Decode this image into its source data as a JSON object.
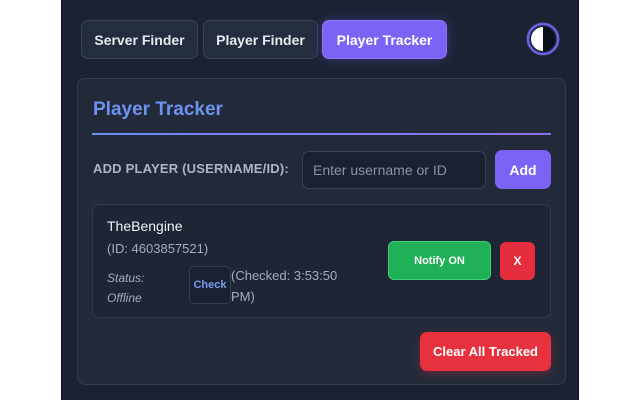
{
  "tabs": [
    {
      "label": "Server Finder",
      "active": false
    },
    {
      "label": "Player Finder",
      "active": false
    },
    {
      "label": "Player Tracker",
      "active": true
    }
  ],
  "theme_toggle": {
    "icon": "contrast-icon"
  },
  "panel": {
    "title": "Player Tracker",
    "add": {
      "label": "ADD PLAYER (USERNAME/ID):",
      "placeholder": "Enter username or ID",
      "value": "",
      "button_label": "Add"
    },
    "players": [
      {
        "name": "TheBengine",
        "id_text": "(ID: 4603857521)",
        "status_label": "Status:",
        "status_value": "Offline",
        "check_label": "Check",
        "checked_text": "(Checked: 3:53:50 PM)",
        "notify_label": "Notify ON",
        "remove_label": "X"
      }
    ],
    "clear_label": "Clear All Tracked"
  },
  "colors": {
    "background": "#1b2333",
    "panel": "#222a39",
    "accent": "#7c63f5",
    "title": "#6d92f0",
    "success": "#20b057",
    "danger": "#e52d3e"
  }
}
